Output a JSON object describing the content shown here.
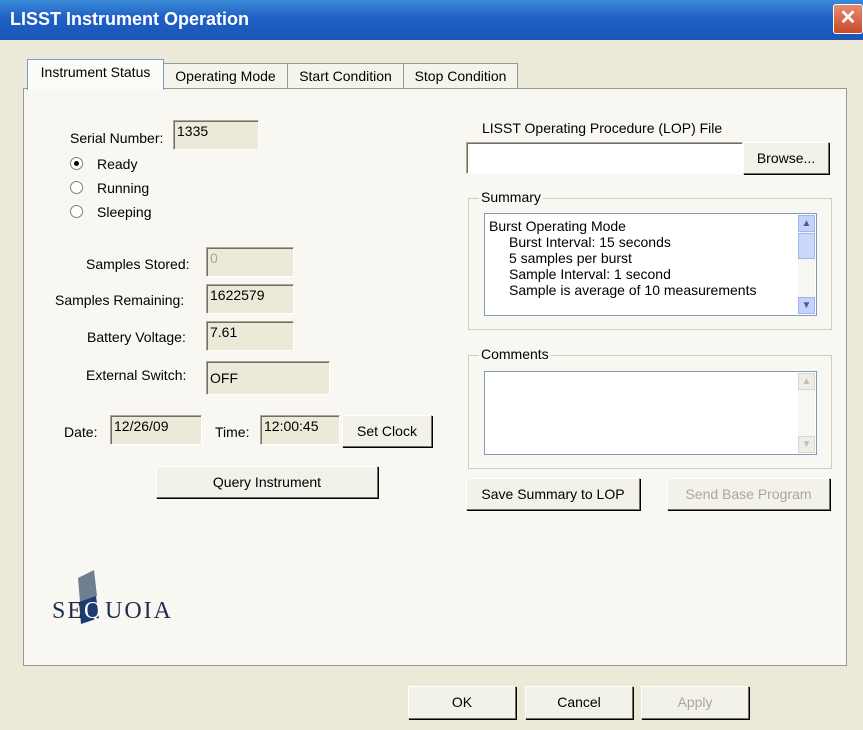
{
  "window": {
    "title": "LISST Instrument Operation",
    "close": "✕"
  },
  "tabs": [
    "Instrument Status",
    "Operating Mode",
    "Start Condition",
    "Stop Condition"
  ],
  "status": {
    "serial_label": "Serial Number:",
    "serial_value": "1335",
    "radios": [
      {
        "label": "Ready",
        "checked": true
      },
      {
        "label": "Running",
        "checked": false
      },
      {
        "label": "Sleeping",
        "checked": false
      }
    ],
    "samples_stored_label": "Samples Stored:",
    "samples_stored_value": "0",
    "samples_remaining_label": "Samples Remaining:",
    "samples_remaining_value": "1622579",
    "battery_label": "Battery Voltage:",
    "battery_value": "7.61",
    "switch_label": "External Switch:",
    "switch_value": "OFF",
    "date_label": "Date:",
    "date_value": "12/26/09",
    "time_label": "Time:",
    "time_value": "12:00:45",
    "set_clock": "Set Clock",
    "query": "Query Instrument"
  },
  "lop": {
    "label": "LISST Operating Procedure (LOP) File",
    "value": "",
    "browse": "Browse..."
  },
  "summary": {
    "legend": "Summary",
    "lines": [
      "Burst Operating Mode",
      "Burst Interval: 15 seconds",
      "5 samples per burst",
      "Sample Interval: 1 second",
      "Sample is average of 10 measurements"
    ]
  },
  "comments": {
    "legend": "Comments",
    "value": ""
  },
  "actions": {
    "save": "Save Summary to LOP",
    "send": "Send Base Program"
  },
  "footer": {
    "ok": "OK",
    "cancel": "Cancel",
    "apply": "Apply"
  },
  "logo": {
    "text_before": "SE",
    "letter": "Q",
    "text_after": "UOIA"
  }
}
